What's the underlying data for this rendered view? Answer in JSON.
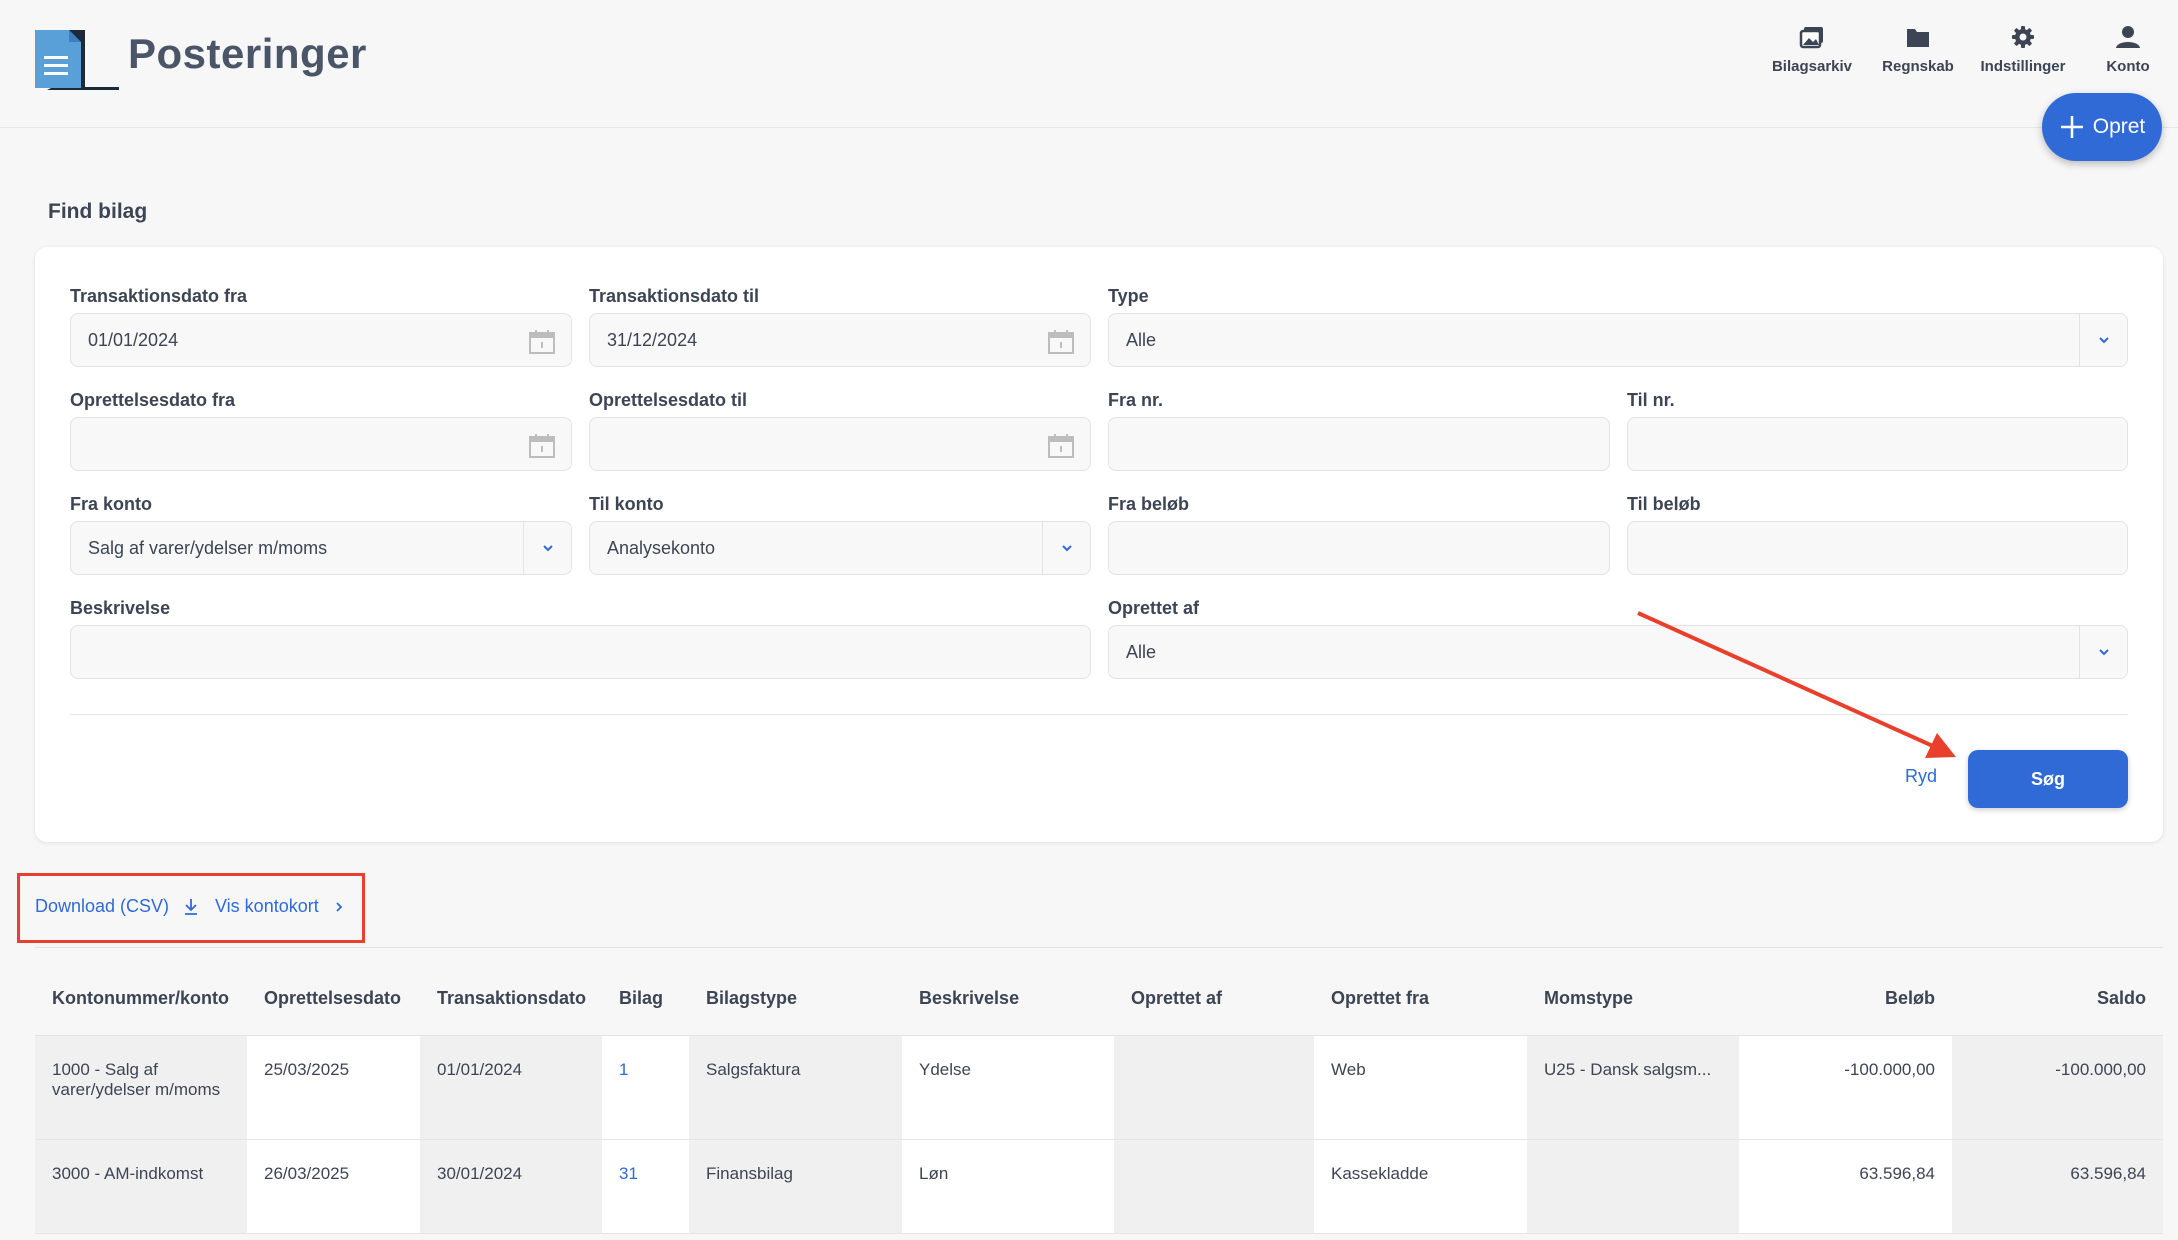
{
  "header": {
    "title": "Posteringer",
    "nav": [
      {
        "label": "Bilagsarkiv",
        "icon": "images-icon"
      },
      {
        "label": "Regnskab",
        "icon": "folder-icon"
      },
      {
        "label": "Indstillinger",
        "icon": "gear-icon"
      },
      {
        "label": "Konto",
        "icon": "user-icon"
      }
    ],
    "create_label": "Opret"
  },
  "search": {
    "title": "Find bilag",
    "fields": {
      "trans_from": {
        "label": "Transaktionsdato fra",
        "value": "01/01/2024"
      },
      "trans_to": {
        "label": "Transaktionsdato til",
        "value": "31/12/2024"
      },
      "type": {
        "label": "Type",
        "value": "Alle"
      },
      "created_from": {
        "label": "Oprettelsesdato fra",
        "value": ""
      },
      "created_to": {
        "label": "Oprettelsesdato til",
        "value": ""
      },
      "from_nr": {
        "label": "Fra nr.",
        "value": ""
      },
      "to_nr": {
        "label": "Til nr.",
        "value": ""
      },
      "from_account": {
        "label": "Fra konto",
        "value": "Salg af varer/ydelser m/moms"
      },
      "to_account": {
        "label": "Til konto",
        "value": "Analysekonto"
      },
      "from_amount": {
        "label": "Fra beløb",
        "value": ""
      },
      "to_amount": {
        "label": "Til beløb",
        "value": ""
      },
      "description": {
        "label": "Beskrivelse",
        "value": ""
      },
      "created_by": {
        "label": "Oprettet af",
        "value": "Alle"
      }
    },
    "clear_label": "Ryd",
    "search_label": "Søg"
  },
  "toolbar": {
    "download_label": "Download (CSV)",
    "account_card_label": "Vis kontokort"
  },
  "table": {
    "columns": [
      "Kontonummer/konto",
      "Oprettelsesdato",
      "Transaktionsdato",
      "Bilag",
      "Bilagstype",
      "Beskrivelse",
      "Oprettet af",
      "Oprettet fra",
      "Momstype",
      "Beløb",
      "Saldo"
    ],
    "rows": [
      [
        "1000 - Salg af varer/ydelser m/moms",
        "25/03/2025",
        "01/01/2024",
        "1",
        "Salgsfaktura",
        "Ydelse",
        "",
        "Web",
        "U25 - Dansk salgsm...",
        "-100.000,00",
        "-100.000,00"
      ],
      [
        "3000 - AM-indkomst",
        "26/03/2025",
        "30/01/2024",
        "31",
        "Finansbilag",
        "Løn",
        "",
        "Kassekladde",
        "",
        "63.596,84",
        "63.596,84"
      ]
    ]
  },
  "colors": {
    "accent": "#2f6ad6",
    "annotation": "#e8402d"
  }
}
